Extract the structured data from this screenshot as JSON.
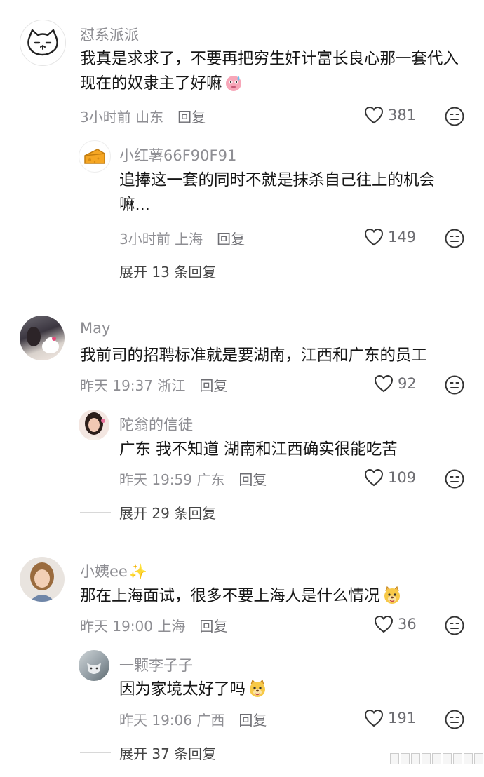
{
  "comments": [
    {
      "user": "怼系派派",
      "text": "我真是求求了，不要再把穷生奸计富长良心那一套代入现在的奴隶主了好嘛",
      "time": "3小时前",
      "location": "山东",
      "reply_label": "回复",
      "likes": "381",
      "avatar": "cat-doodle-avatar",
      "reply": {
        "user": "小红薯66F90F91",
        "text": "追捧这一套的同时不就是抹杀自己往上的机会嘛...",
        "time": "3小时前",
        "location": "上海",
        "reply_label": "回复",
        "likes": "149",
        "avatar": "cheese-avatar"
      },
      "expand_label": "展开 13 条回复"
    },
    {
      "user": "May",
      "text": "我前司的招聘标准就是要湖南，江西和广东的员工",
      "time": "昨天 19:37",
      "location": "浙江",
      "reply_label": "回复",
      "likes": "92",
      "avatar": "photo-avatar",
      "reply": {
        "user": "陀翁的信徒",
        "text": "广东 我不知道  湖南和江西确实很能吃苦",
        "time": "昨天 19:59",
        "location": "广东",
        "reply_label": "回复",
        "likes": "109",
        "avatar": "portrait-avatar"
      },
      "expand_label": "展开 29 条回复"
    },
    {
      "user": "小姨ee",
      "text": "那在上海面试，很多不要上海人是什么情况",
      "time": "昨天 19:00",
      "location": "上海",
      "reply_label": "回复",
      "likes": "36",
      "avatar": "selfie-avatar",
      "reply": {
        "user": "一颗李子子",
        "text": "因为家境太好了吗",
        "time": "昨天 19:06",
        "location": "广西",
        "reply_label": "回复",
        "likes": "191",
        "avatar": "cat-photo-avatar"
      },
      "expand_label": "展开 37 条回复"
    }
  ],
  "colors": {
    "text": "#161616",
    "meta": "#8e8e93",
    "cheese": "#f5a623",
    "emoji_face": "#f7c948"
  }
}
